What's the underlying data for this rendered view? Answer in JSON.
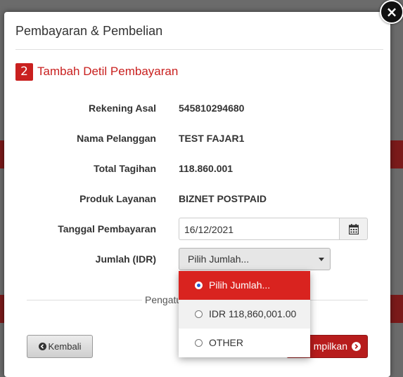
{
  "modal": {
    "title": "Pembayaran & Pembelian",
    "close_symbol": "×"
  },
  "step": {
    "number": "2",
    "title": "Tambah Detil Pembayaran"
  },
  "fields": [
    {
      "label": "Rekening Asal",
      "value": "545810294680"
    },
    {
      "label": "Nama Pelanggan",
      "value": "TEST FAJAR1"
    },
    {
      "label": "Total Tagihan",
      "value": "118.860.001"
    },
    {
      "label": "Produk Layanan",
      "value": "BIZNET POSTPAID"
    }
  ],
  "payment_date": {
    "label": "Tanggal Pembayaran",
    "value": "16/12/2021",
    "icon": "calendar-icon"
  },
  "amount": {
    "label": "Jumlah (IDR)",
    "selected": "Pilih Jumlah...",
    "options": [
      "Pilih Jumlah...",
      "IDR 118,860,001.00",
      "OTHER"
    ]
  },
  "section_caption": "Pengatu",
  "buttons": {
    "back_label": "Kembali",
    "show_label": "mpilkan"
  },
  "colors": {
    "accent": "#c9201f",
    "dropdown_active": "#d9231f",
    "primary_button": "#b71c1c"
  }
}
